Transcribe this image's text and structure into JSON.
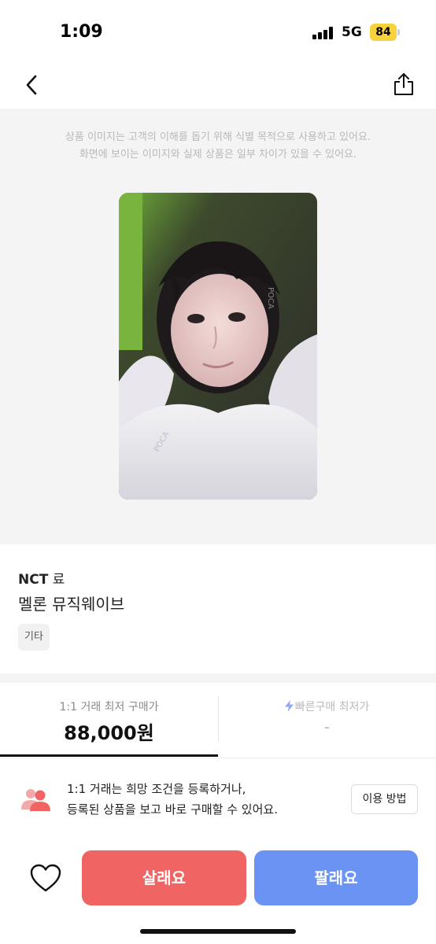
{
  "status_bar": {
    "time": "1:09",
    "network": "5G",
    "battery": "84",
    "battery_color": "#f7d23b"
  },
  "nav": {
    "back_icon": "chevron-left-icon",
    "share_icon": "share-icon"
  },
  "image_notice": {
    "line1": "상품 이미지는 고객의 이해를 돕기 위해 식별 목적으로 사용하고 있어요.",
    "line2": "화면에 보이는 이미지와 실제 상품은 일부 차이가 있을 수 있어요."
  },
  "product": {
    "brand": "NCT",
    "member": "료",
    "name": "멜론 뮤직웨이브",
    "tag": "기타",
    "image_watermark": "POCA"
  },
  "price_tabs": {
    "tab1_label": "1:1 거래 최저 구매가",
    "tab1_value": "88,000원",
    "tab2_label": "빠른구매 최저가",
    "tab2_value": "-",
    "tab2_icon": "lightning-icon",
    "accent_color": "#8fa8f2"
  },
  "guide": {
    "line1": "1:1 거래는 희망 조건을 등록하거나,",
    "line2": "등록된 상품을 보고 바로 구매할 수 있어요.",
    "button_label": "이용 방법",
    "icon": "users-icon",
    "icon_color": "#f06464"
  },
  "bottom": {
    "buy_label": "살래요",
    "sell_label": "팔래요",
    "buy_color": "#f06464",
    "sell_color": "#6a93f4",
    "like_icon": "heart-icon"
  }
}
